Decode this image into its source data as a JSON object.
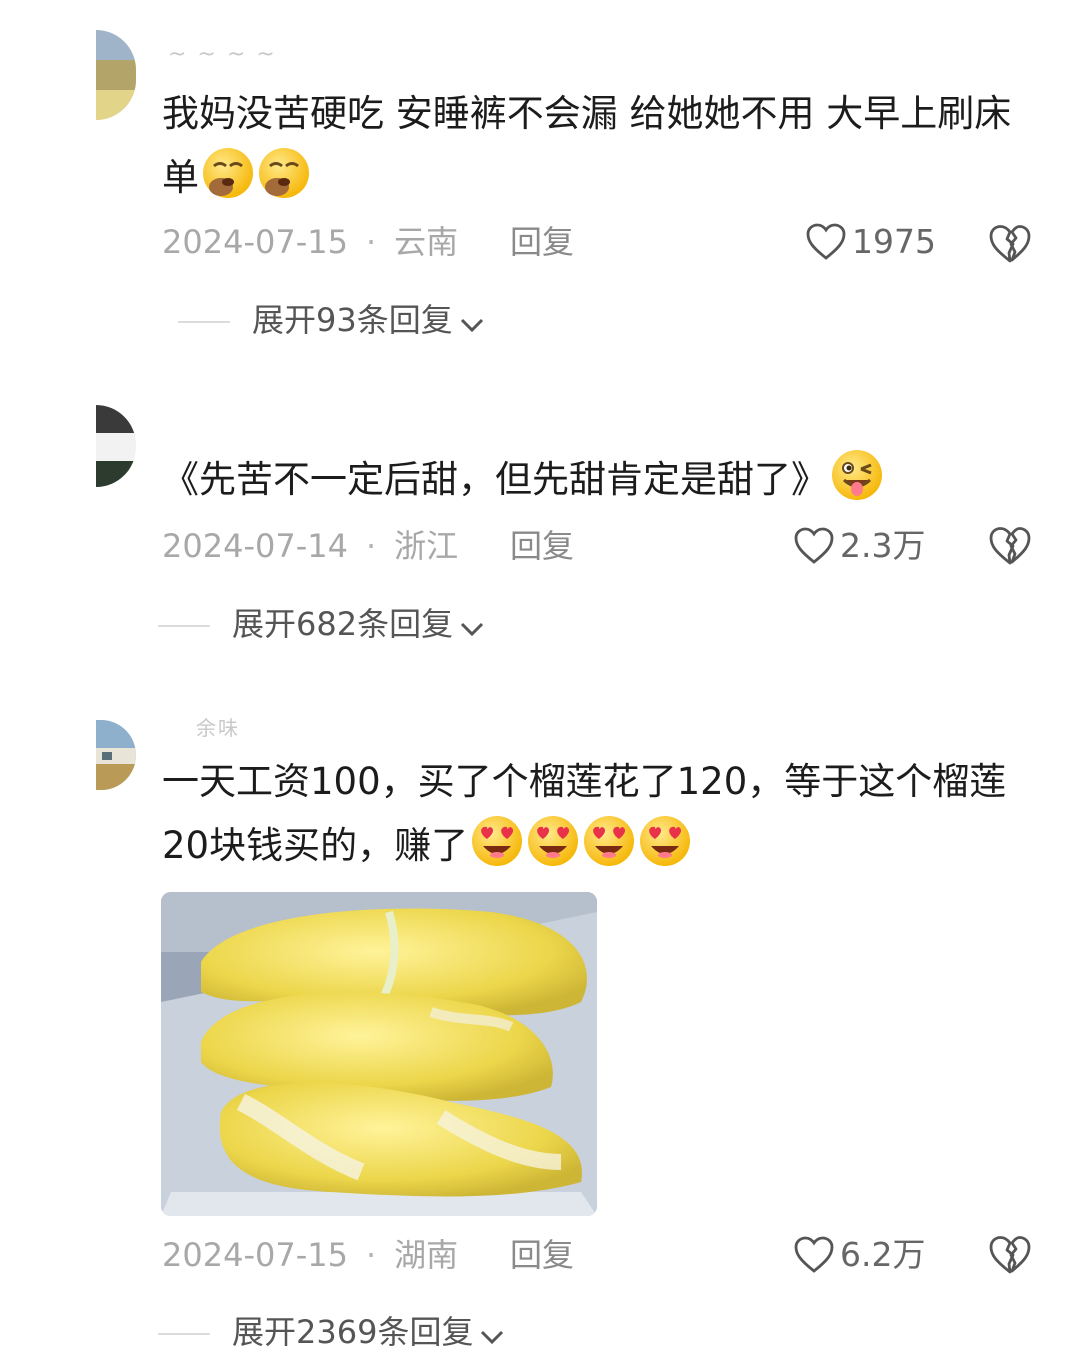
{
  "comments": [
    {
      "text": "我妈没苦硬吃 安睡裤不会漏 给她她不用 大早上刷床单",
      "emoji_count": 2,
      "emoji_type": "yawn-emoji",
      "date": "2024-07-15",
      "location": "云南",
      "reply_label": "回复",
      "likes": "1975",
      "expand_label": "展开93条回复"
    },
    {
      "text": "《先苦不一定后甜，但先甜肯定是甜了》",
      "emoji_count": 1,
      "emoji_type": "wink-tongue-emoji",
      "date": "2024-07-14",
      "location": "浙江",
      "reply_label": "回复",
      "likes": "2.3万",
      "expand_label": "展开682条回复"
    },
    {
      "username": "余味",
      "text": "一天工资100，买了个榴莲花了120，等于这个榴莲20块钱买的，赚了",
      "emoji_count": 4,
      "emoji_type": "heart-eyes-emoji",
      "date": "2024-07-15",
      "location": "湖南",
      "reply_label": "回复",
      "likes": "6.2万",
      "expand_label": "展开2369条回复"
    }
  ],
  "separator": "·",
  "icons": {
    "like": "heart-outline-icon",
    "dislike": "broken-heart-icon",
    "expand": "chevron-down-icon"
  },
  "colors": {
    "meta": "#a8a8a8",
    "text": "#1c1c1c",
    "durian": "#f0dc5a"
  }
}
